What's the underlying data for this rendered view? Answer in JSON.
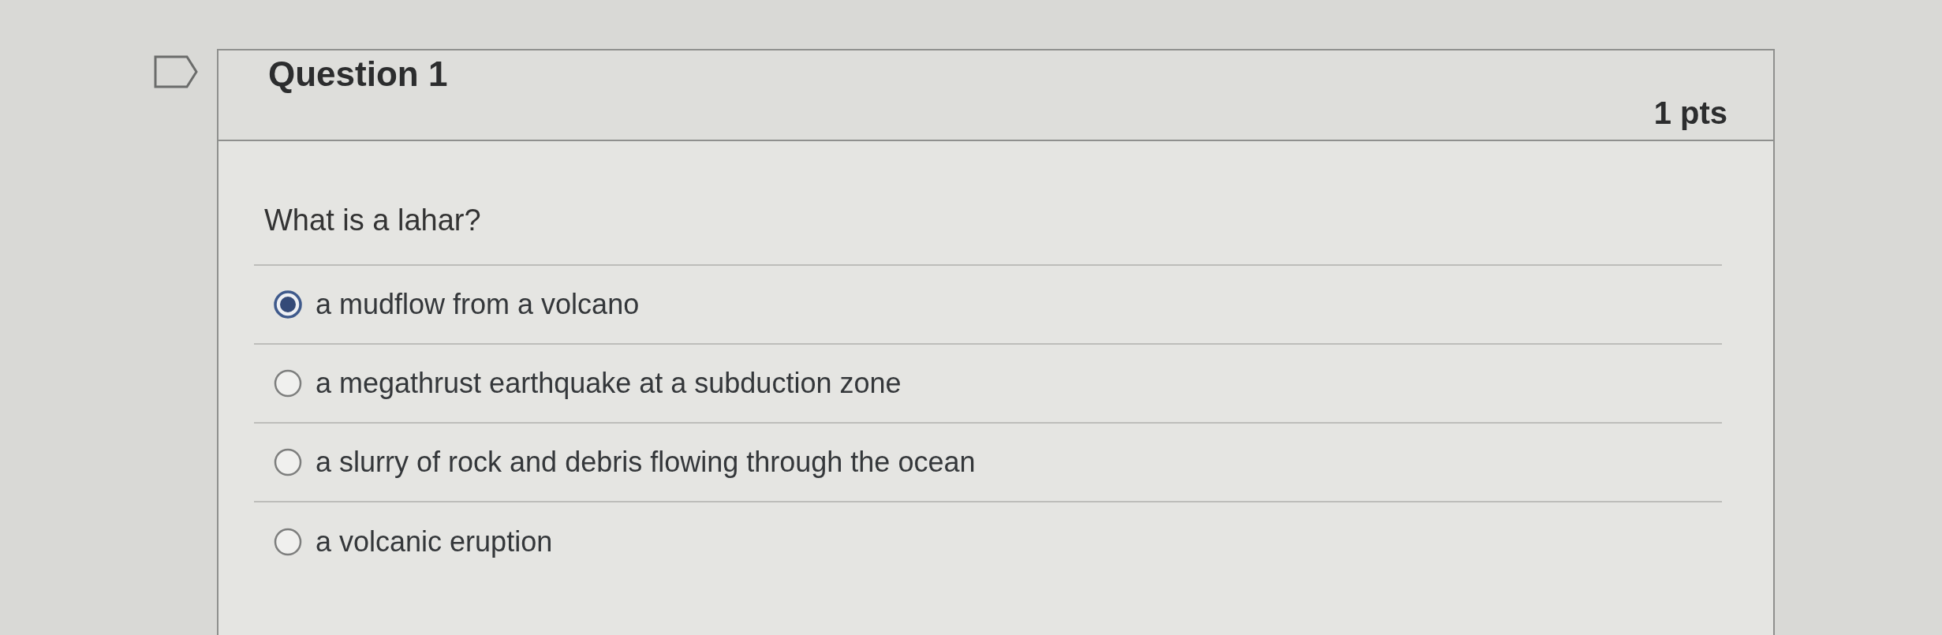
{
  "question": {
    "title": "Question 1",
    "points": "1 pts",
    "flagged": false,
    "prompt": "What is a lahar?"
  },
  "answers": [
    {
      "label": "a mudflow from a volcano",
      "selected": true
    },
    {
      "label": "a megathrust earthquake at a subduction zone",
      "selected": false
    },
    {
      "label": "a slurry of rock and debris flowing through the ocean",
      "selected": false
    },
    {
      "label": "a volcanic eruption",
      "selected": false
    }
  ]
}
